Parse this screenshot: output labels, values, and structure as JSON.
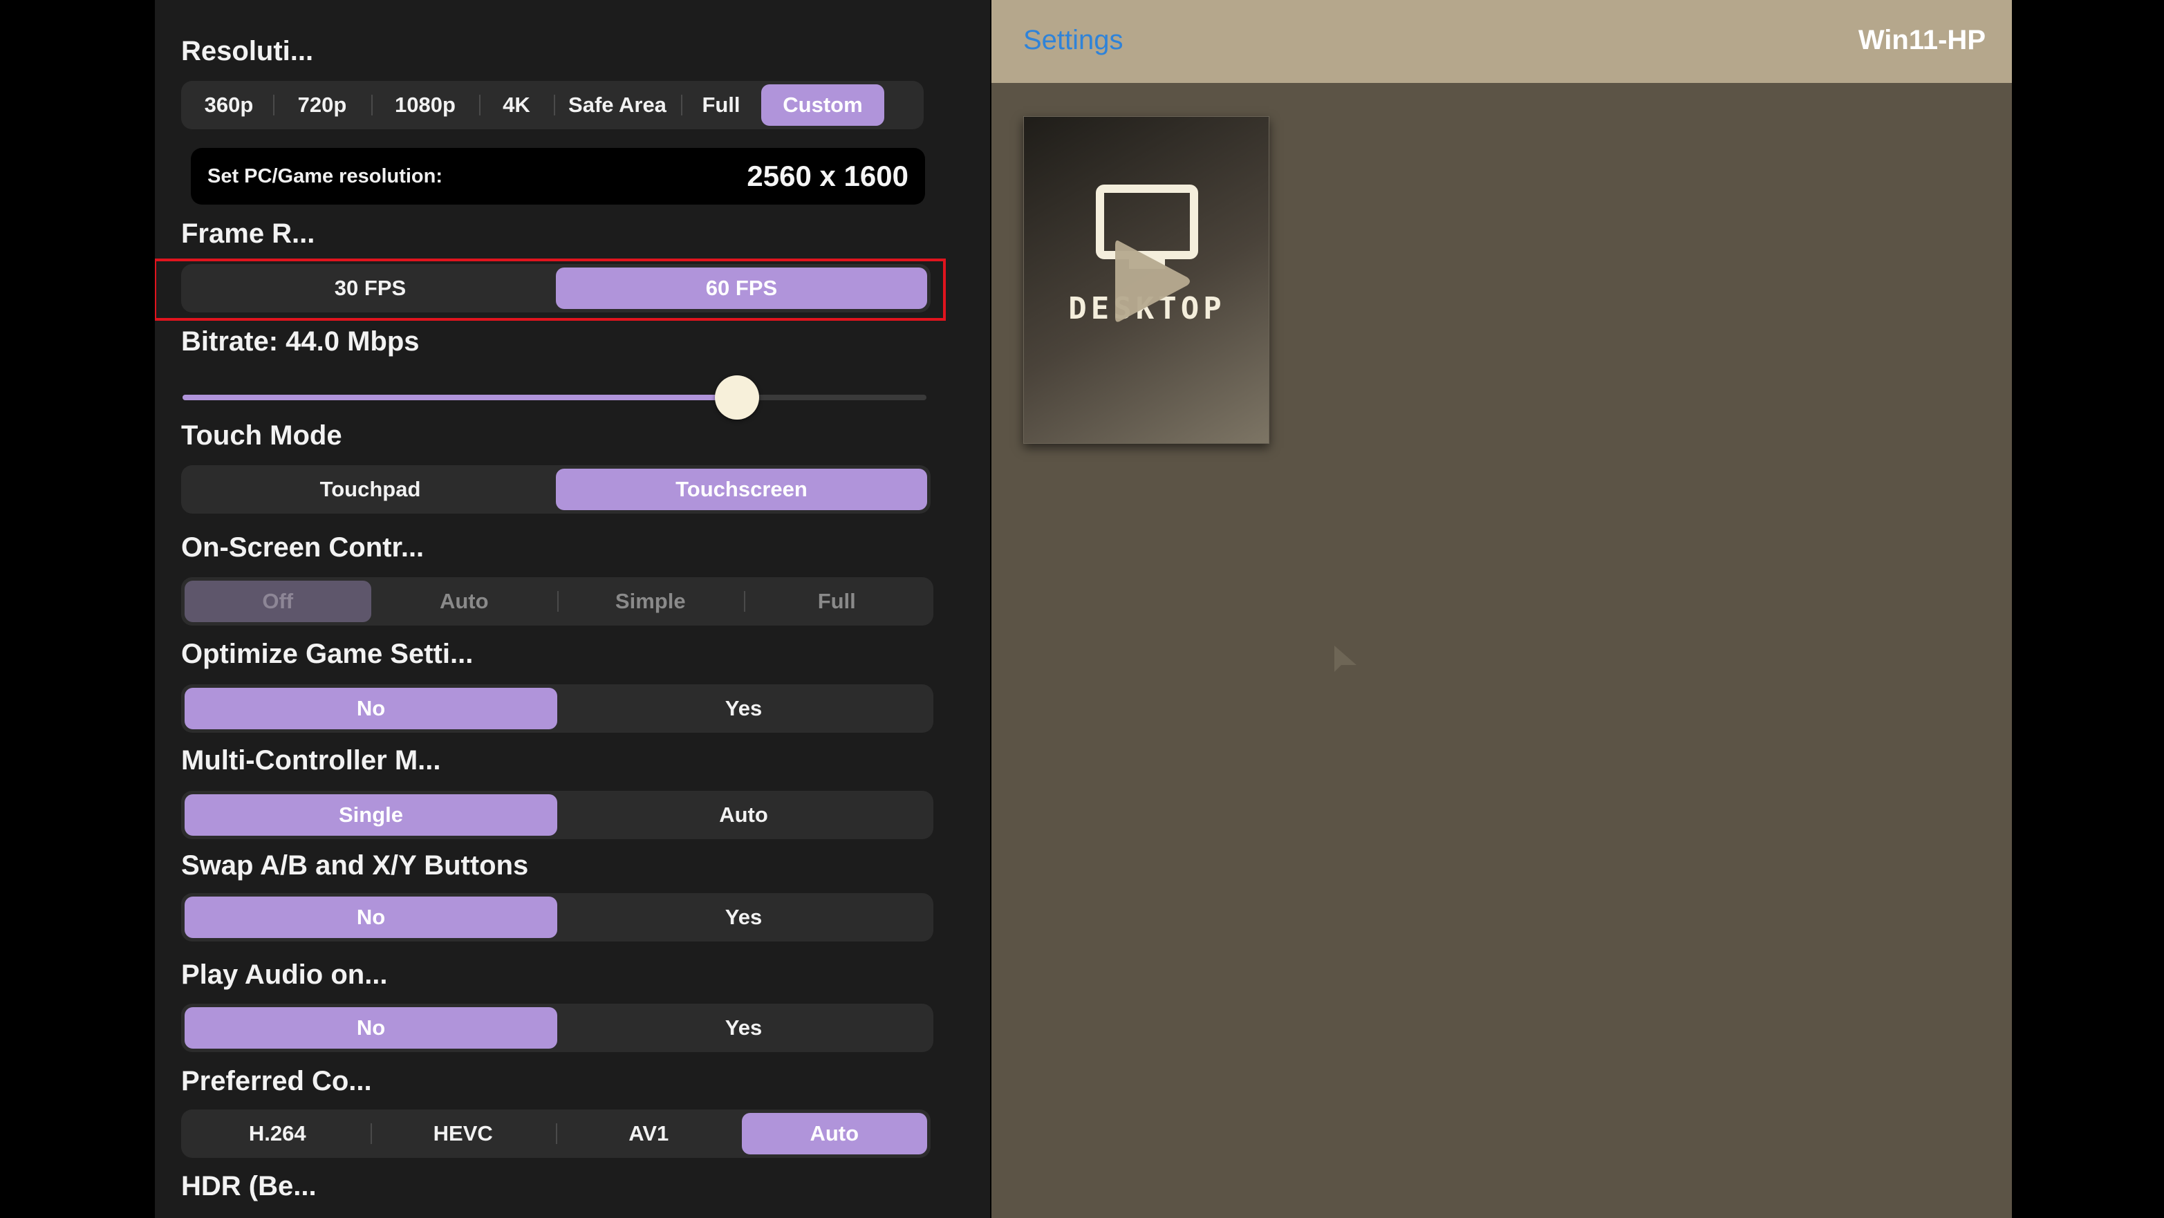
{
  "settings": {
    "resolution": {
      "title": "Resoluti...",
      "options": [
        "360p",
        "720p",
        "1080p",
        "4K",
        "Safe Area",
        "Full",
        "Custom"
      ],
      "selected": "Custom",
      "field_label": "Set PC/Game resolution:",
      "field_value": "2560 x 1600"
    },
    "frame_rate": {
      "title": "Frame R...",
      "options": [
        "30 FPS",
        "60 FPS"
      ],
      "selected": "60 FPS"
    },
    "bitrate": {
      "title": "Bitrate: 44.0 Mbps",
      "slider_fraction": 0.745
    },
    "touch_mode": {
      "title": "Touch Mode",
      "options": [
        "Touchpad",
        "Touchscreen"
      ],
      "selected": "Touchscreen"
    },
    "on_screen_controls": {
      "title": "On-Screen Contr...",
      "options": [
        "Off",
        "Auto",
        "Simple",
        "Full"
      ],
      "selected": "Off",
      "disabled": true
    },
    "optimize_game_settings": {
      "title": "Optimize Game Setti...",
      "options": [
        "No",
        "Yes"
      ],
      "selected": "No"
    },
    "multi_controller": {
      "title": "Multi-Controller M...",
      "options": [
        "Single",
        "Auto"
      ],
      "selected": "Single"
    },
    "swap_buttons": {
      "title": "Swap A/B and X/Y Buttons",
      "options": [
        "No",
        "Yes"
      ],
      "selected": "No"
    },
    "play_audio": {
      "title": "Play Audio on...",
      "options": [
        "No",
        "Yes"
      ],
      "selected": "No"
    },
    "preferred_codec": {
      "title": "Preferred Co...",
      "options": [
        "H.264",
        "HEVC",
        "AV1",
        "Auto"
      ],
      "selected": "Auto"
    },
    "hdr": {
      "title": "HDR (Be..."
    }
  },
  "nav": {
    "back_label": "Settings",
    "title": "Win11-HP"
  },
  "app_card": {
    "label": "DESKTOP",
    "icon": "monitor-icon",
    "overlay_icon": "play-icon"
  },
  "colors": {
    "accent": "#b094da",
    "panel": "#1c1c1c",
    "pane": "#5c5446",
    "nav_bar": "#b5a78c",
    "link": "#2f83d9",
    "highlight": "#e0141e"
  }
}
